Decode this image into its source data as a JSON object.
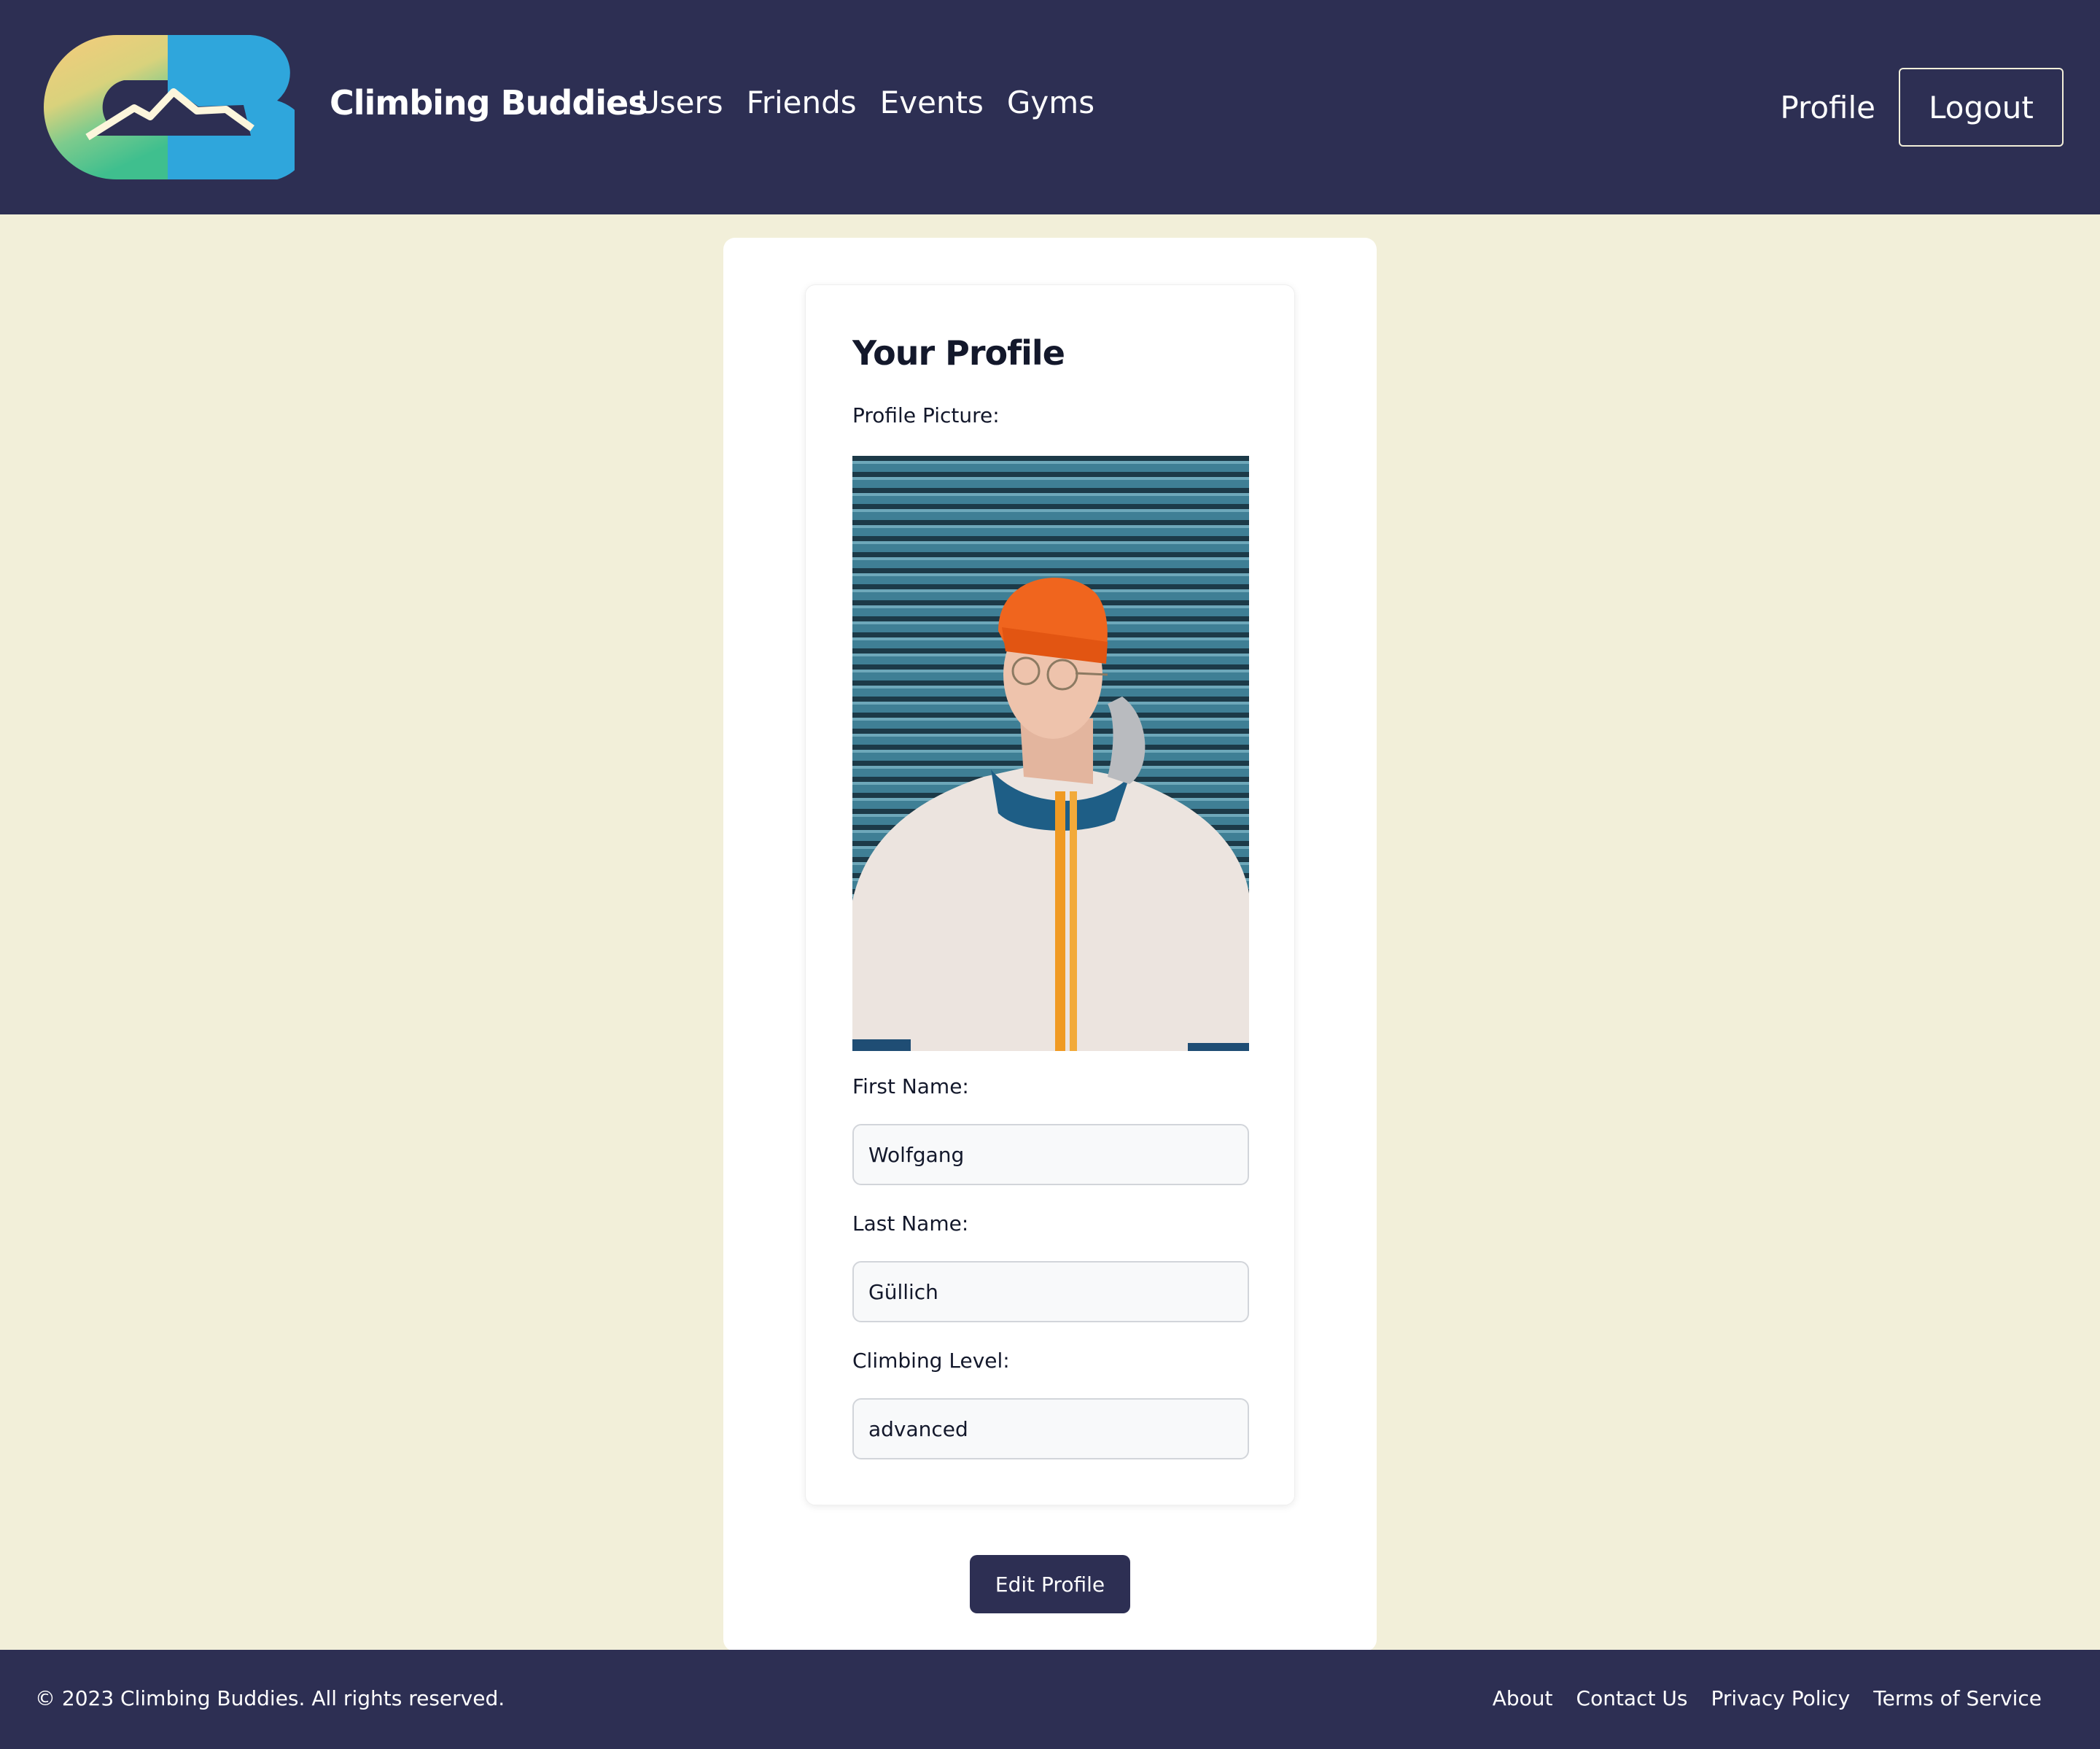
{
  "navbar": {
    "logo_icon": "climbing-buddies-logo",
    "brand": "Climbing Buddies",
    "links": [
      {
        "label": "Users"
      },
      {
        "label": "Friends"
      },
      {
        "label": "Events"
      },
      {
        "label": "Gyms"
      }
    ],
    "profile_link": "Profile",
    "logout_label": "Logout"
  },
  "profile": {
    "title": "Your Profile",
    "picture_label": "Profile Picture:",
    "first_name_label": "First Name:",
    "first_name_value": "Wolfgang",
    "last_name_label": "Last Name:",
    "last_name_value": "Güllich",
    "climbing_level_label": "Climbing Level:",
    "climbing_level_value": "advanced",
    "edit_button": "Edit Profile"
  },
  "footer": {
    "copyright": "© 2023 Climbing Buddies. All rights reserved.",
    "links": [
      {
        "label": "About"
      },
      {
        "label": "Contact Us"
      },
      {
        "label": "Privacy Policy"
      },
      {
        "label": "Terms of Service"
      }
    ]
  },
  "colors": {
    "navy": "#2d2f53",
    "cream": "#f2efd9",
    "logo_blue": "#2fa6dc",
    "logo_yellow": "#f5cc7a",
    "logo_green": "#5cc79a",
    "hat_orange": "#f0651e"
  }
}
